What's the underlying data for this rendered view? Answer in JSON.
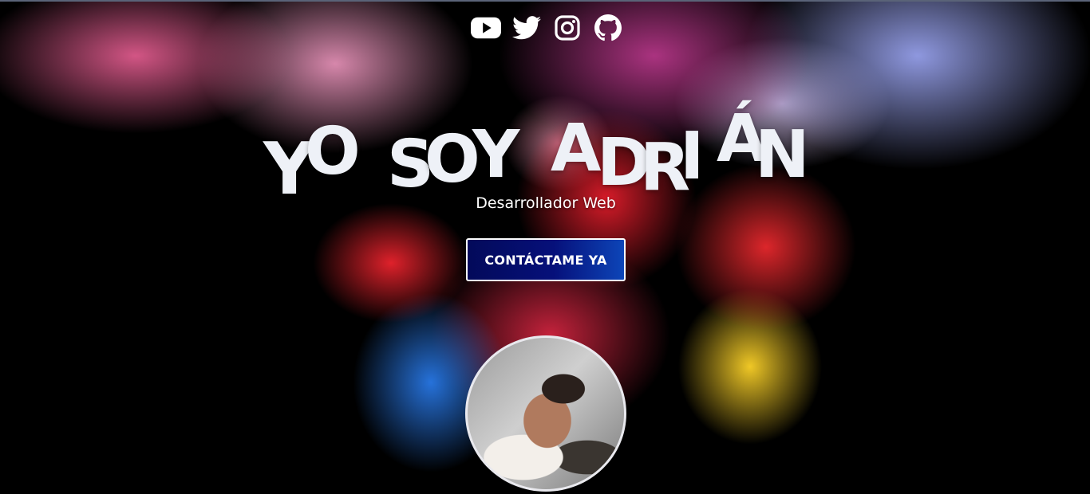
{
  "social": {
    "icons": [
      "youtube-icon",
      "twitter-icon",
      "instagram-icon",
      "github-icon"
    ]
  },
  "hero": {
    "title": "YO SOY ADRIÁN",
    "title_letters": [
      "Y",
      "O",
      "S",
      "O",
      "Y",
      "A",
      "D",
      "R",
      "I",
      "Á",
      "N"
    ],
    "subtitle": "Desarrollador Web",
    "cta_label": "CONTÁCTAME YA"
  },
  "colors": {
    "background": "#000000",
    "title": "#eef1f7",
    "button_start": "#030a5a",
    "button_end": "#0d45b8",
    "button_border": "#ffffff"
  }
}
